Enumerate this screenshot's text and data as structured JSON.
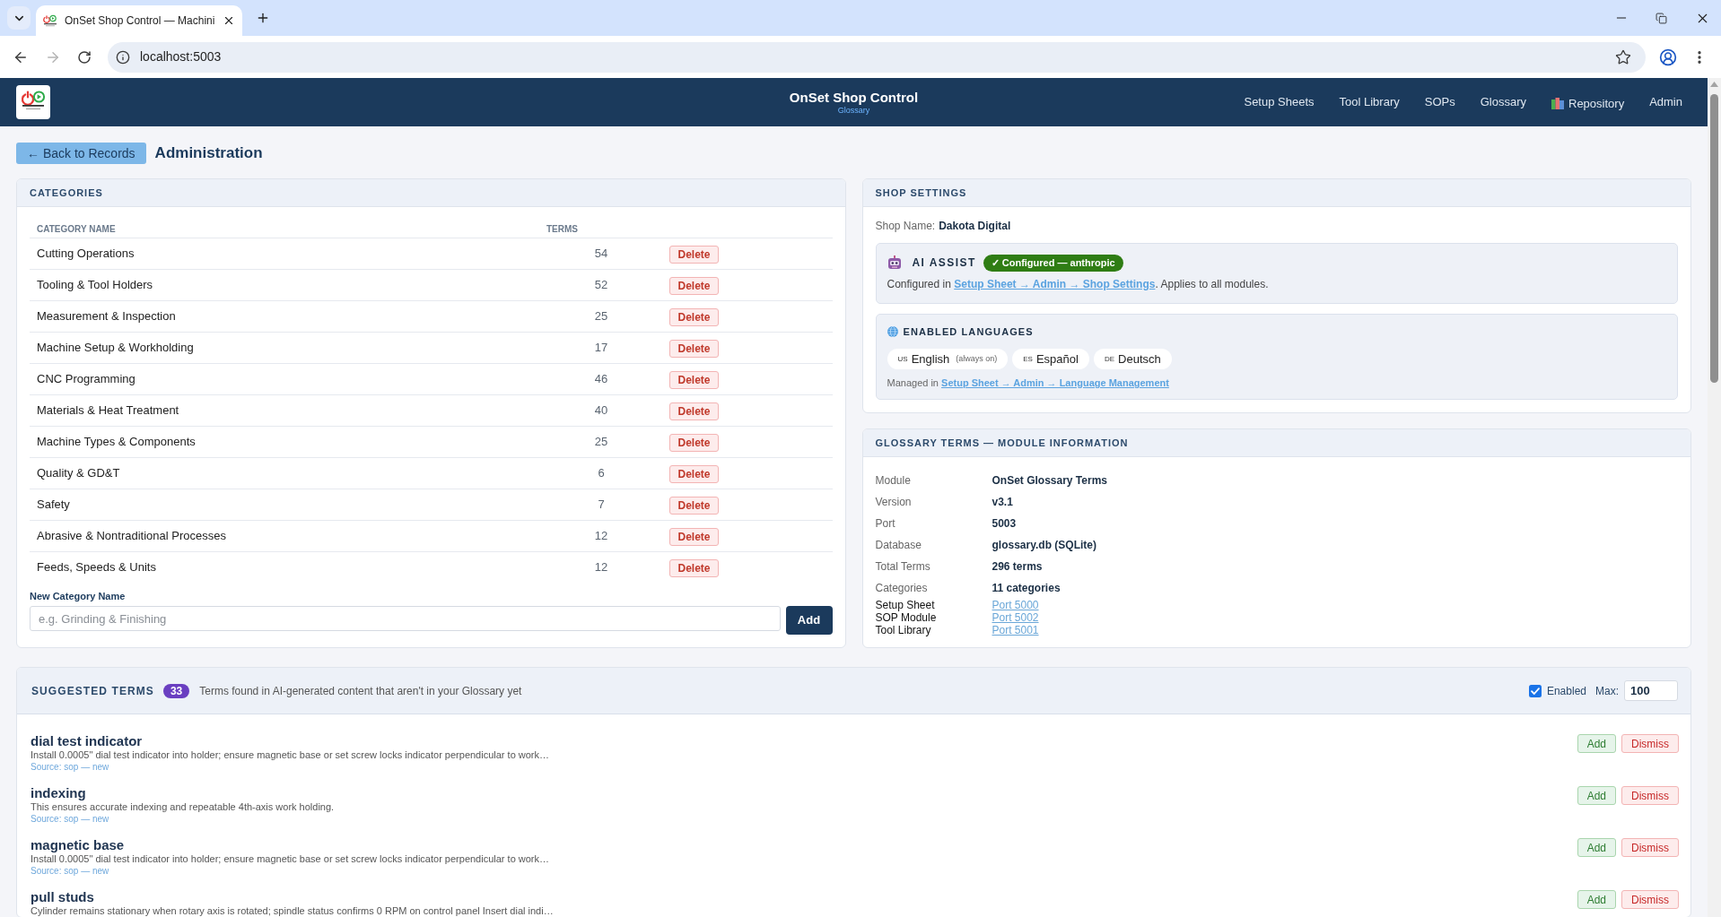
{
  "browser": {
    "tab_title": "OnSet Shop Control — Machini",
    "url": "localhost:5003"
  },
  "header": {
    "title": "OnSet Shop Control",
    "subtitle": "Glossary",
    "nav": [
      {
        "label": "Setup Sheets",
        "kind": "plain"
      },
      {
        "label": "Tool Library",
        "kind": "plain"
      },
      {
        "label": "SOPs",
        "kind": "plain"
      },
      {
        "label": "Glossary",
        "kind": "plain"
      },
      {
        "label": "Repository",
        "kind": "with_icon"
      },
      {
        "label": "Admin",
        "kind": "plain"
      }
    ]
  },
  "toolbar": {
    "back_button": "← Back to Records",
    "title": "Administration"
  },
  "categories": {
    "title": "CATEGORIES",
    "columns": [
      "CATEGORY NAME",
      "TERMS"
    ],
    "rows": [
      {
        "name": "Cutting Operations",
        "terms": "54",
        "action": "Delete"
      },
      {
        "name": "Tooling & Tool Holders",
        "terms": "52",
        "action": "Delete"
      },
      {
        "name": "Measurement & Inspection",
        "terms": "25",
        "action": "Delete"
      },
      {
        "name": "Machine Setup & Workholding",
        "terms": "17",
        "action": "Delete"
      },
      {
        "name": "CNC Programming",
        "terms": "46",
        "action": "Delete"
      },
      {
        "name": "Materials & Heat Treatment",
        "terms": "40",
        "action": "Delete"
      },
      {
        "name": "Machine Types & Components",
        "terms": "25",
        "action": "Delete"
      },
      {
        "name": "Quality & GD&T",
        "terms": "6",
        "action": "Delete"
      },
      {
        "name": "Safety",
        "terms": "7",
        "action": "Delete"
      },
      {
        "name": "Abrasive & Nontraditional Processes",
        "terms": "12",
        "action": "Delete"
      },
      {
        "name": "Feeds, Speeds & Units",
        "terms": "12",
        "action": "Delete"
      }
    ],
    "new_category": {
      "label": "New Category Name",
      "placeholder": "e.g. Grinding & Finishing",
      "button": "Add"
    }
  },
  "shop_settings": {
    "title": "SHOP SETTINGS",
    "shop_name": {
      "label": "Shop Name:",
      "value": "Dakota Digital"
    },
    "ai_assist": {
      "title": "AI ASSIST",
      "status": "✓ Configured — anthropic",
      "text_before": "Configured in ",
      "link": "Setup Sheet → Admin → Shop Settings",
      "text_after": ". Applies to all modules."
    },
    "languages": {
      "title": "ENABLED LANGUAGES",
      "items": [
        {
          "code": "US",
          "name": "English",
          "note": "(always on)"
        },
        {
          "code": "ES",
          "name": "Español"
        },
        {
          "code": "DE",
          "name": "Deutsch"
        }
      ],
      "text_before": "Managed in ",
      "link": "Setup Sheet → Admin → Language Management"
    }
  },
  "module_info": {
    "title": "GLOSSARY TERMS — MODULE INFORMATION",
    "rows": [
      {
        "kind": "value",
        "label": "Module",
        "value": "OnSet Glossary Terms"
      },
      {
        "kind": "value",
        "label": "Version",
        "value": "v3.1"
      },
      {
        "kind": "value",
        "label": "Port",
        "value": "5003"
      },
      {
        "kind": "value",
        "label": "Database",
        "value": "glossary.db (SQLite)"
      },
      {
        "kind": "value",
        "label": "Total Terms",
        "value": "296 terms"
      },
      {
        "kind": "value",
        "label": "Categories",
        "value": "11 categories"
      },
      {
        "kind": "link",
        "label": "Setup Sheet",
        "value": "Port 5000"
      },
      {
        "kind": "link",
        "label": "SOP Module",
        "value": "Port 5002"
      },
      {
        "kind": "link",
        "label": "Tool Library",
        "value": "Port 5001"
      }
    ]
  },
  "suggested_terms": {
    "title": "SUGGESTED TERMS",
    "count": "33",
    "description": "Terms found in AI-generated content that aren't in your Glossary yet",
    "enabled": {
      "label": "Enabled",
      "checked": true
    },
    "max": {
      "label": "Max:",
      "value": "100"
    },
    "items": [
      {
        "term": "dial test indicator",
        "snippet": "Install 0.0005\" dial test indicator into holder; ensure magnetic base or set screw locks indicator perpendicular to work…",
        "source": "Source: sop — new",
        "actions": [
          "Add",
          "Dismiss"
        ]
      },
      {
        "term": "indexing",
        "snippet": "This ensures accurate indexing and repeatable 4th-axis work holding.",
        "source": "Source: sop — new",
        "actions": [
          "Add",
          "Dismiss"
        ]
      },
      {
        "term": "magnetic base",
        "snippet": "Install 0.0005\" dial test indicator into holder; ensure magnetic base or set screw locks indicator perpendicular to work…",
        "source": "Source: sop — new",
        "actions": [
          "Add",
          "Dismiss"
        ]
      },
      {
        "term": "pull studs",
        "snippet": "Cylinder remains stationary when rotary axis is rotated; spindle status confirms 0 RPM on control panel Insert dial indi…",
        "actions": [
          "Add",
          "Dismiss"
        ]
      }
    ]
  }
}
